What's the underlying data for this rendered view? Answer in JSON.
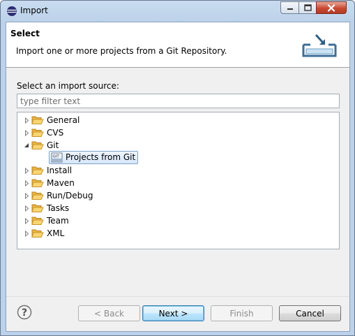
{
  "window": {
    "title": "Import",
    "icons": {
      "app": "eclipse-icon",
      "minimize": "minimize-icon",
      "maximize": "maximize-icon",
      "close": "close-icon"
    }
  },
  "header": {
    "title": "Select",
    "description": "Import one or more projects from a Git Repository.",
    "icon": "import-wizard-icon"
  },
  "source": {
    "label": "Select an import source:",
    "filter_placeholder": "type filter text",
    "filter_value": ""
  },
  "tree": {
    "items": [
      {
        "label": "General",
        "expanded": false
      },
      {
        "label": "CVS",
        "expanded": false
      },
      {
        "label": "Git",
        "expanded": true,
        "children": [
          {
            "label": "Projects from Git",
            "selected": true,
            "icon": "git-repository-icon"
          }
        ]
      },
      {
        "label": "Install",
        "expanded": false
      },
      {
        "label": "Maven",
        "expanded": false
      },
      {
        "label": "Run/Debug",
        "expanded": false
      },
      {
        "label": "Tasks",
        "expanded": false
      },
      {
        "label": "Team",
        "expanded": false
      },
      {
        "label": "XML",
        "expanded": false
      }
    ]
  },
  "footer": {
    "help_icon": "help-icon",
    "back_label": "< Back",
    "next_label": "Next >",
    "finish_label": "Finish",
    "cancel_label": "Cancel"
  },
  "colors": {
    "frame": "#bcd2ea",
    "close_button": "#c94a32",
    "folder": "#f5c556",
    "selection": "#d6e7fb",
    "default_button": "#3c7fb1"
  }
}
